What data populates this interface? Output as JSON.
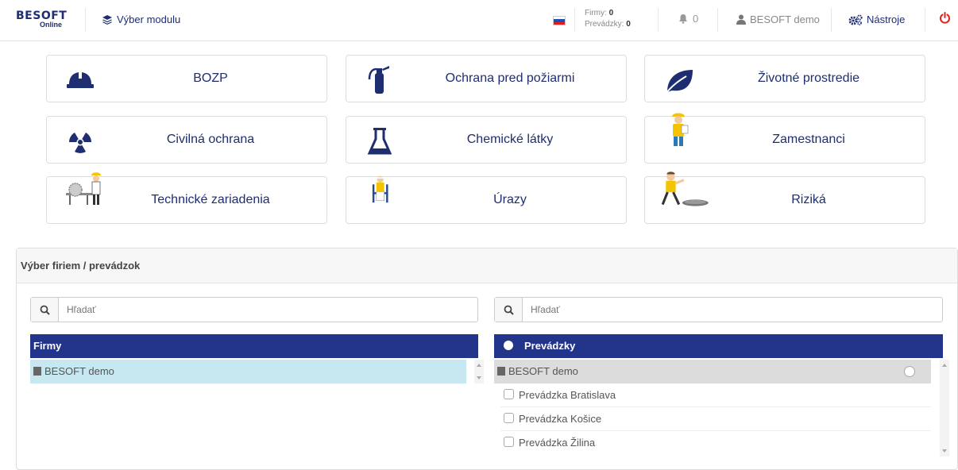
{
  "topbar": {
    "logo_main": "BESOFT",
    "logo_sub": "Online",
    "module_label": "Výber modulu",
    "counts": {
      "firmy_label": "Firmy:",
      "firmy_value": "0",
      "prevadzky_label": "Prevádzky:",
      "prevadzky_value": "0"
    },
    "notifications": "0",
    "user": "BESOFT demo",
    "tools": "Nástroje"
  },
  "tiles": [
    {
      "label": "BOZP",
      "icon": "hardhat-icon"
    },
    {
      "label": "Ochrana pred požiarmi",
      "icon": "fire-extinguisher-icon"
    },
    {
      "label": "Životné prostredie",
      "icon": "leaf-icon"
    },
    {
      "label": "Civilná ochrana",
      "icon": "radiation-icon"
    },
    {
      "label": "Chemické látky",
      "icon": "flask-icon"
    },
    {
      "label": "Zamestnanci",
      "icon": "worker-icon"
    },
    {
      "label": "Technické zariadenia",
      "icon": "saw-worker-icon"
    },
    {
      "label": "Úrazy",
      "icon": "injured-person-icon"
    },
    {
      "label": "Riziká",
      "icon": "manhole-worker-icon"
    }
  ],
  "panel": {
    "title": "Výber firiem / prevádzok",
    "left": {
      "search_placeholder": "Hľadať",
      "header": "Firmy",
      "rows": [
        "BESOFT demo"
      ]
    },
    "right": {
      "search_placeholder": "Hľadať",
      "header": "Prevádzky",
      "group": "BESOFT demo",
      "rows": [
        "Prevádzka Bratislava",
        "Prevádzka Košice",
        "Prevádzka Žilina"
      ]
    }
  },
  "colors": {
    "brand": "#1e2e70",
    "table_header": "#23358a",
    "selected_row": "#c7e8f0",
    "group_row": "#dcdcdc",
    "power": "#e02020"
  }
}
